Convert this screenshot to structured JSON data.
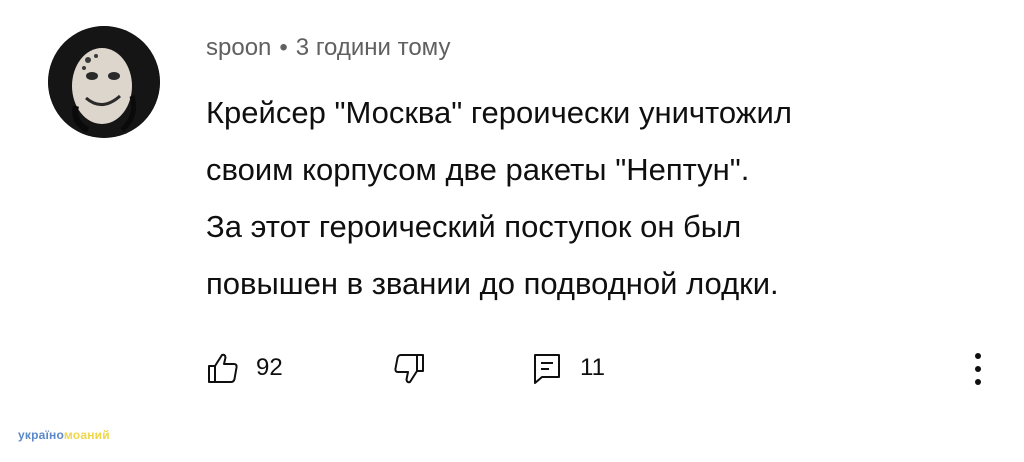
{
  "comment": {
    "author": "spoon",
    "separator": "•",
    "time_ago": "3 години тому",
    "text_lines": [
      "Крейсер \"Москва\" героически уничтожил",
      "своим корпусом две ракеты \"Нептун\".",
      "За этот героический поступок он был",
      "повышен в звании до подводной лодки."
    ],
    "likes": "92",
    "replies": "11"
  },
  "icons": {
    "like": "thumbs-up-icon",
    "dislike": "thumbs-down-icon",
    "reply": "reply-comment-icon",
    "more": "vertical-dots-icon"
  },
  "watermark": {
    "part1": "україно",
    "part2": "моаний"
  },
  "colors": {
    "background": "#ffffff",
    "text": "#0f0f0f",
    "meta": "#606060",
    "watermark_blue": "#5b88c8",
    "watermark_yellow": "#f0d64a"
  }
}
